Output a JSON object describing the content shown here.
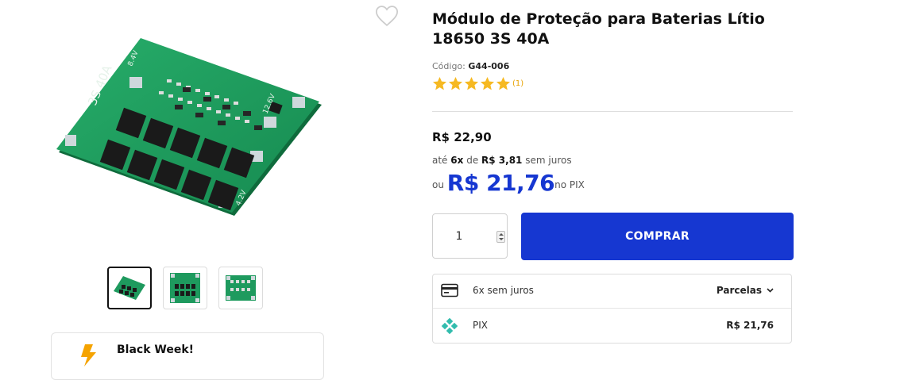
{
  "product": {
    "title_line1": "Módulo de Proteção para Baterias Lítio",
    "title_line2": "18650 3S 40A",
    "code_label": "Código:",
    "code_value": "G44-006",
    "rating_stars": 5,
    "rating_count": "(1)"
  },
  "pricing": {
    "price": "R$ 22,90",
    "installment_prefix": "até",
    "installment_times": "6x",
    "installment_de": "de",
    "installment_value": "R$ 3,81",
    "installment_suffix": "sem juros",
    "pix_prefix": "ou",
    "pix_price": "R$ 21,76",
    "pix_suffix": "no PIX"
  },
  "purchase": {
    "quantity": "1",
    "buy_label": "COMPRAR"
  },
  "payment_options": {
    "card_label": "6x sem juros",
    "card_action": "Parcelas",
    "pix_label": "PIX",
    "pix_value": "R$ 21,76"
  },
  "gallery": {
    "board_labels": [
      "3S 40A",
      "8.4V",
      "12.6V",
      "4.2V"
    ],
    "thumbnail_count": 3,
    "active_thumbnail": 0
  },
  "promo": {
    "text": "Black Week!"
  },
  "colors": {
    "accent": "#1637d1",
    "star": "#f6b922",
    "pcb_green": "#1e9a5e",
    "pix_teal": "#32bcad",
    "promo_orange": "#f5a300"
  }
}
